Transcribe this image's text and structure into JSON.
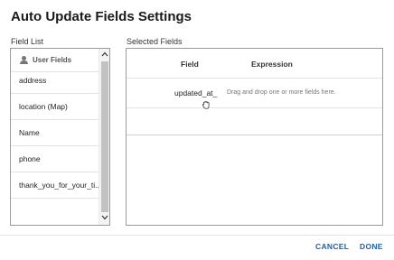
{
  "dialog": {
    "title": "Auto Update Fields Settings"
  },
  "field_list": {
    "label": "Field List",
    "group_header": "User Fields",
    "items": [
      {
        "label": "address"
      },
      {
        "label": "location (Map)"
      },
      {
        "label": "Name"
      },
      {
        "label": "phone"
      },
      {
        "label": "thank_you_for_your_ti..."
      }
    ]
  },
  "selected_fields": {
    "label": "Selected Fields",
    "columns": {
      "field": "Field",
      "expression": "Expression"
    },
    "rows": [
      {
        "field": "updated_at_",
        "expression": "Drag and drop one or more fields here."
      }
    ]
  },
  "footer": {
    "cancel_label": "CANCEL",
    "done_label": "DONE"
  },
  "colors": {
    "accent": "#1f5f9b"
  }
}
